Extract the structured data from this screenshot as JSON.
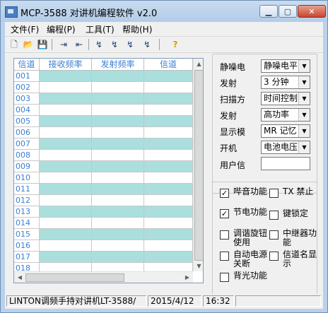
{
  "window": {
    "title": "MCP-3588 对讲机编程软件 v2.0"
  },
  "menu": [
    {
      "label": "文件(F)"
    },
    {
      "label": "编程(P)"
    },
    {
      "label": "工具(T)"
    },
    {
      "label": "帮助(H)"
    }
  ],
  "toolbar": [
    {
      "icon": "new-file-icon"
    },
    {
      "icon": "open-folder-icon"
    },
    {
      "icon": "save-icon"
    },
    {
      "icon": "read-from-radio-icon"
    },
    {
      "icon": "write-to-radio-icon"
    },
    {
      "icon": "radio-tool-1-icon"
    },
    {
      "icon": "radio-tool-2-icon"
    },
    {
      "icon": "radio-tool-3-icon"
    },
    {
      "icon": "radio-tool-4-icon"
    },
    {
      "icon": "help-icon"
    }
  ],
  "grid": {
    "columns": [
      "信道",
      "接收频率",
      "发射频率",
      "信道"
    ],
    "rows": [
      "001",
      "002",
      "003",
      "004",
      "005",
      "006",
      "007",
      "008",
      "009",
      "010",
      "011",
      "012",
      "013",
      "014",
      "015",
      "016",
      "017",
      "018"
    ]
  },
  "settings": {
    "fields": [
      {
        "label": "静噪电",
        "value": "静噪电平"
      },
      {
        "label": "发射",
        "value": "3 分钟"
      },
      {
        "label": "扫描方",
        "value": "时间控制"
      },
      {
        "label": "发射",
        "value": "高功率"
      },
      {
        "label": "显示模",
        "value": "MR 记忆"
      },
      {
        "label": "开机",
        "value": "电池电压"
      },
      {
        "label": "用户信",
        "value": ""
      }
    ]
  },
  "options": [
    {
      "label": "哔音功能",
      "checked": true
    },
    {
      "label": "TX 禁止",
      "checked": false
    },
    {
      "label": "节电功能",
      "checked": true
    },
    {
      "label": "键锁定",
      "checked": false
    },
    {
      "label": "调谐旋钮使用",
      "checked": false
    },
    {
      "label": "中继器功能",
      "checked": false
    },
    {
      "label": "自动电源关断",
      "checked": false
    },
    {
      "label": "信道名显示",
      "checked": false
    },
    {
      "label": "背光功能",
      "checked": false
    }
  ],
  "status": {
    "model": "LINTON调频手持对讲机LT-3588/",
    "date": "2015/4/12",
    "time": "16:32"
  }
}
